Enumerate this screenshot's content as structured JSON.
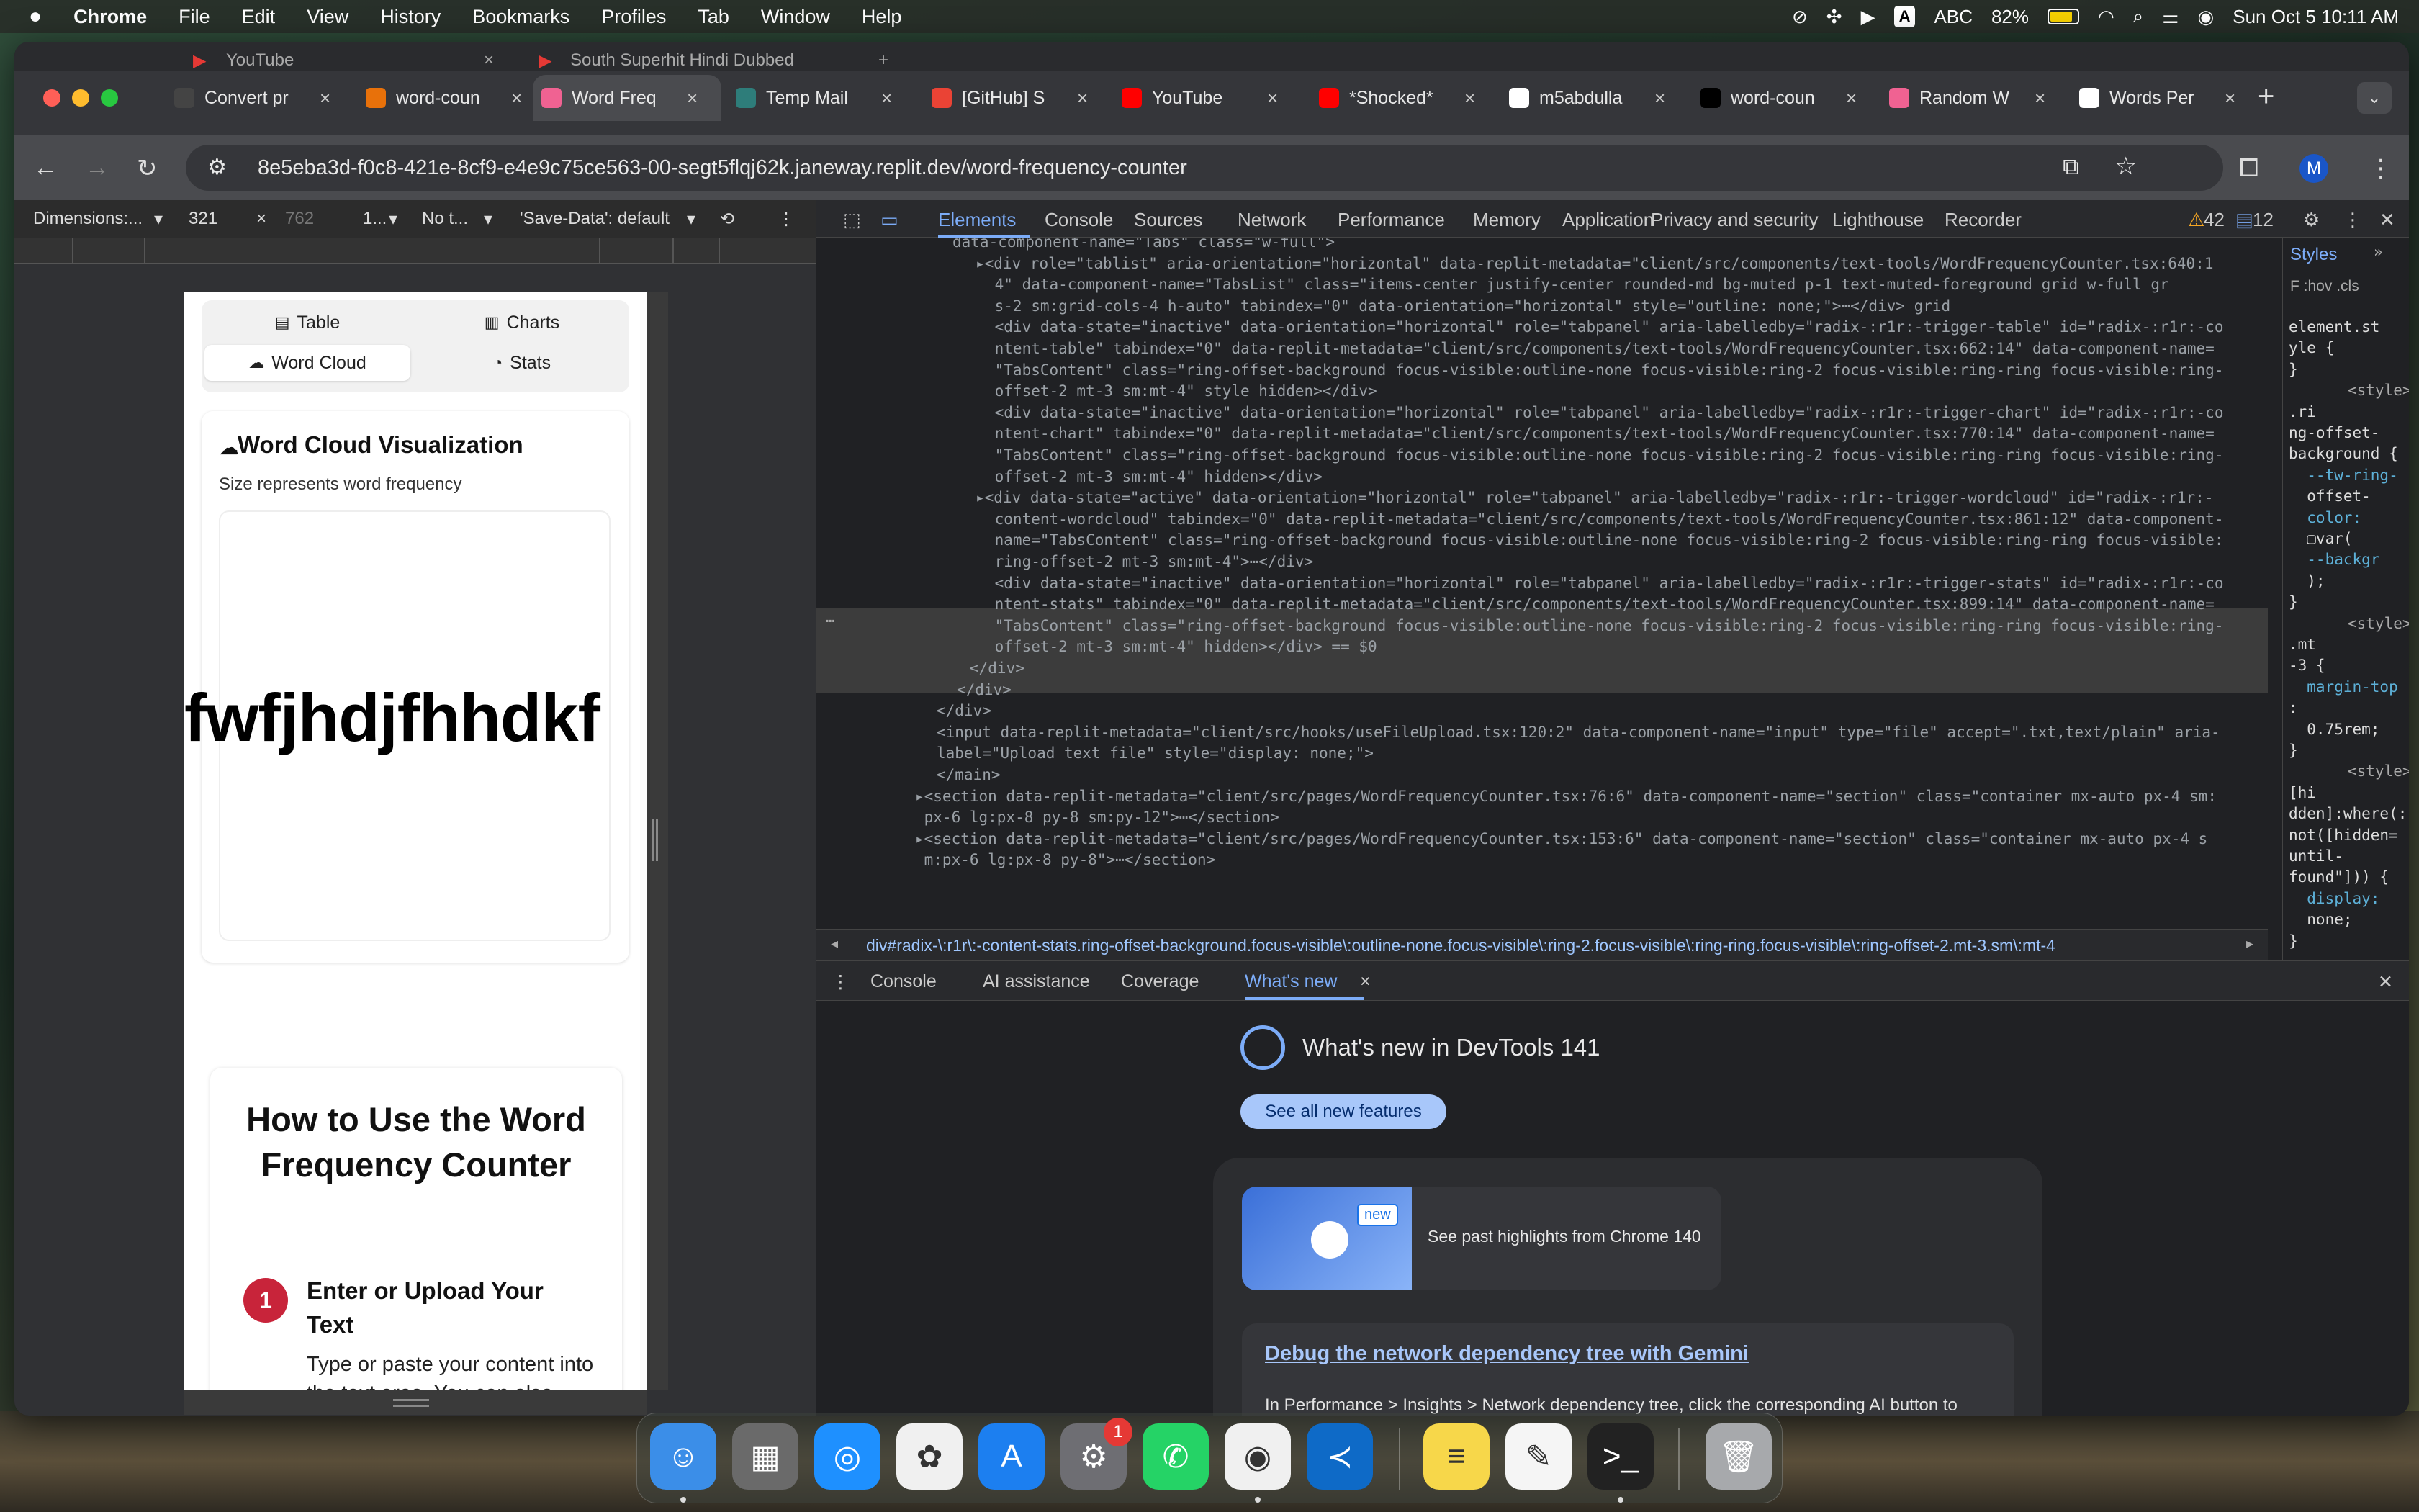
{
  "menubar": {
    "app": "Chrome",
    "items": [
      "File",
      "Edit",
      "View",
      "History",
      "Bookmarks",
      "Profiles",
      "Tab",
      "Window",
      "Help"
    ],
    "input_source": "ABC",
    "input_badge": "A",
    "battery": "82%",
    "datetime": "Sun Oct 5  10:11 AM"
  },
  "back_tabs": [
    {
      "label": "YouTube"
    },
    {
      "label": "South Superhit Hindi Dubbed"
    }
  ],
  "tabs": [
    {
      "label": "Convert pr",
      "color": "#444"
    },
    {
      "label": "word-coun",
      "color": "#e8710a"
    },
    {
      "label": "Word Freq",
      "color": "#f06292"
    },
    {
      "label": "Temp Mail",
      "color": "#2e7d7a"
    },
    {
      "label": "[GitHub] S",
      "color": "#ea4335"
    },
    {
      "label": "YouTube",
      "color": "#ff0000"
    },
    {
      "label": "*Shocked*",
      "color": "#ff0000"
    },
    {
      "label": "m5abdulla",
      "color": "#ffffff"
    },
    {
      "label": "word-coun",
      "color": "#000000"
    },
    {
      "label": "Random W",
      "color": "#f06292"
    },
    {
      "label": "Words Per",
      "color": "#ffffff"
    }
  ],
  "url": "8e5eba3d-f0c8-421e-8cf9-e4e9c75ce563-00-segt5flqj62k.janeway.replit.dev/word-frequency-counter",
  "profile_initial": "M",
  "device_bar": {
    "dimensions": "Dimensions:...",
    "width": "321",
    "height": "762",
    "zoom": "1...",
    "throttle": "No t...",
    "save_data": "'Save-Data': default"
  },
  "devtools_tabs": [
    "Elements",
    "Console",
    "Sources",
    "Network",
    "Performance",
    "Memory",
    "Application",
    "Privacy and security",
    "Lighthouse",
    "Recorder"
  ],
  "devtools_counts": {
    "warnings": "42",
    "issues": "12"
  },
  "page": {
    "tabs": [
      {
        "icon": "▤",
        "label": "Table"
      },
      {
        "icon": "▥",
        "label": "Charts"
      },
      {
        "icon": "☁",
        "label": "Word Cloud"
      },
      {
        "icon": "◔",
        "label": "Stats"
      }
    ],
    "card_title": "Word Cloud Visualization",
    "card_sub": "Size represents word frequency",
    "cloud_word": "fwfjhdjfhhdkf",
    "howto_title": "How to Use the Word Frequency Counter",
    "step_num": "1",
    "step_title": "Enter or Upload Your Text",
    "step_desc": "Type or paste your content into the text area. You can also upload a .txt file using"
  },
  "elements_lines": [
    "data-component-name=\"Tabs\" class=\"w-full\">",
    "▸<div role=\"tablist\" aria-orientation=\"horizontal\" data-replit-metadata=\"client/src/components/text-tools/WordFrequencyCounter.tsx:640:1",
    " 4\" data-component-name=\"TabsList\" class=\"items-center justify-center rounded-md bg-muted p-1 text-muted-foreground grid w-full gr",
    " s-2 sm:grid-cols-4 h-auto\" tabindex=\"0\" data-orientation=\"horizontal\" style=\"outline: none;\">⋯</div> grid",
    " <div data-state=\"inactive\" data-orientation=\"horizontal\" role=\"tabpanel\" aria-labelledby=\"radix-:r1r:-trigger-table\" id=\"radix-:r1r:-co",
    " ntent-table\" tabindex=\"0\" data-replit-metadata=\"client/src/components/text-tools/WordFrequencyCounter.tsx:662:14\" data-component-name=",
    " \"TabsContent\" class=\"ring-offset-background focus-visible:outline-none focus-visible:ring-2 focus-visible:ring-ring focus-visible:ring-",
    " offset-2 mt-3 sm:mt-4\" style hidden></div>",
    " <div data-state=\"inactive\" data-orientation=\"horizontal\" role=\"tabpanel\" aria-labelledby=\"radix-:r1r:-trigger-chart\" id=\"radix-:r1r:-co",
    " ntent-chart\" tabindex=\"0\" data-replit-metadata=\"client/src/components/text-tools/WordFrequencyCounter.tsx:770:14\" data-component-name=",
    " \"TabsContent\" class=\"ring-offset-background focus-visible:outline-none focus-visible:ring-2 focus-visible:ring-ring focus-visible:ring-",
    " offset-2 mt-3 sm:mt-4\" hidden></div>",
    "▸<div data-state=\"active\" data-orientation=\"horizontal\" role=\"tabpanel\" aria-labelledby=\"radix-:r1r:-trigger-wordcloud\" id=\"radix-:r1r:-",
    " content-wordcloud\" tabindex=\"0\" data-replit-metadata=\"client/src/components/text-tools/WordFrequencyCounter.tsx:861:12\" data-component-",
    " name=\"TabsContent\" class=\"ring-offset-background focus-visible:outline-none focus-visible:ring-2 focus-visible:ring-ring focus-visible:",
    " ring-offset-2 mt-3 sm:mt-4\">⋯</div>",
    " <div data-state=\"inactive\" data-orientation=\"horizontal\" role=\"tabpanel\" aria-labelledby=\"radix-:r1r:-trigger-stats\" id=\"radix-:r1r:-co",
    " ntent-stats\" tabindex=\"0\" data-replit-metadata=\"client/src/components/text-tools/WordFrequencyCounter.tsx:899:14\" data-component-name=",
    " \"TabsContent\" class=\"ring-offset-background focus-visible:outline-none focus-visible:ring-2 focus-visible:ring-ring focus-visible:ring-",
    " offset-2 mt-3 sm:mt-4\" hidden></div> == $0",
    "</div>",
    "</div>",
    "</div>",
    "<input data-replit-metadata=\"client/src/hooks/useFileUpload.tsx:120:2\" data-component-name=\"input\" type=\"file\" accept=\".txt,text/plain\" aria-",
    "label=\"Upload text file\" style=\"display: none;\">",
    "</main>",
    "▸<section data-replit-metadata=\"client/src/pages/WordFrequencyCounter.tsx:76:6\" data-component-name=\"section\" class=\"container mx-auto px-4 sm:",
    " px-6 lg:px-8 py-8 sm:py-12\">⋯</section>",
    "▸<section data-replit-metadata=\"client/src/pages/WordFrequencyCounter.tsx:153:6\" data-component-name=\"section\" class=\"container mx-auto px-4 s",
    " m:px-6 lg:px-8 py-8\">⋯</section>"
  ],
  "breadcrumb": "div#radix-\\:r1r\\:-content-stats.ring-offset-background.focus-visible\\:outline-none.focus-visible\\:ring-2.focus-visible\\:ring-ring.focus-visible\\:ring-offset-2.mt-3.sm\\:mt-4",
  "styles": {
    "tab": "Styles",
    "filter": "F :hov .cls",
    "rules": [
      "element.st",
      "yle {",
      "}",
      "<style>",
      ".ri",
      "ng-offset-",
      "background {",
      "  --tw-ring-",
      "  offset-",
      "  color:",
      "  ▢var(",
      "  --backgr",
      "  );",
      "}",
      "<style>",
      ".mt",
      "-3 {",
      "  margin-top",
      ":",
      "  0.75rem;",
      "}",
      "<style>",
      "[hi",
      "dden]:where(:",
      "not([hidden=",
      "until-",
      "found\"])) {",
      "  display:",
      "  none;",
      "}"
    ]
  },
  "drawer_tabs": [
    "Console",
    "AI assistance",
    "Coverage",
    "What's new"
  ],
  "whatsnew": {
    "title": "What's new in DevTools 141",
    "button": "See all new features",
    "new_badge": "new",
    "past": "See past highlights from Chrome 140",
    "link": "Debug the network dependency tree with Gemini",
    "desc": "In Performance > Insights > Network dependency tree, click the corresponding AI button to discuss and debug said tree with Gemini in the 'AI assistance' panel."
  },
  "dock": {
    "badge": "1",
    "apps": [
      "finder-icon",
      "launchpad-icon",
      "safari-icon",
      "photos-icon",
      "app-store-icon",
      "system-settings-icon",
      "whatsapp-icon",
      "chrome-icon",
      "vscode-icon",
      "notes-icon",
      "textedit-icon",
      "terminal-icon",
      "trash-icon"
    ]
  }
}
